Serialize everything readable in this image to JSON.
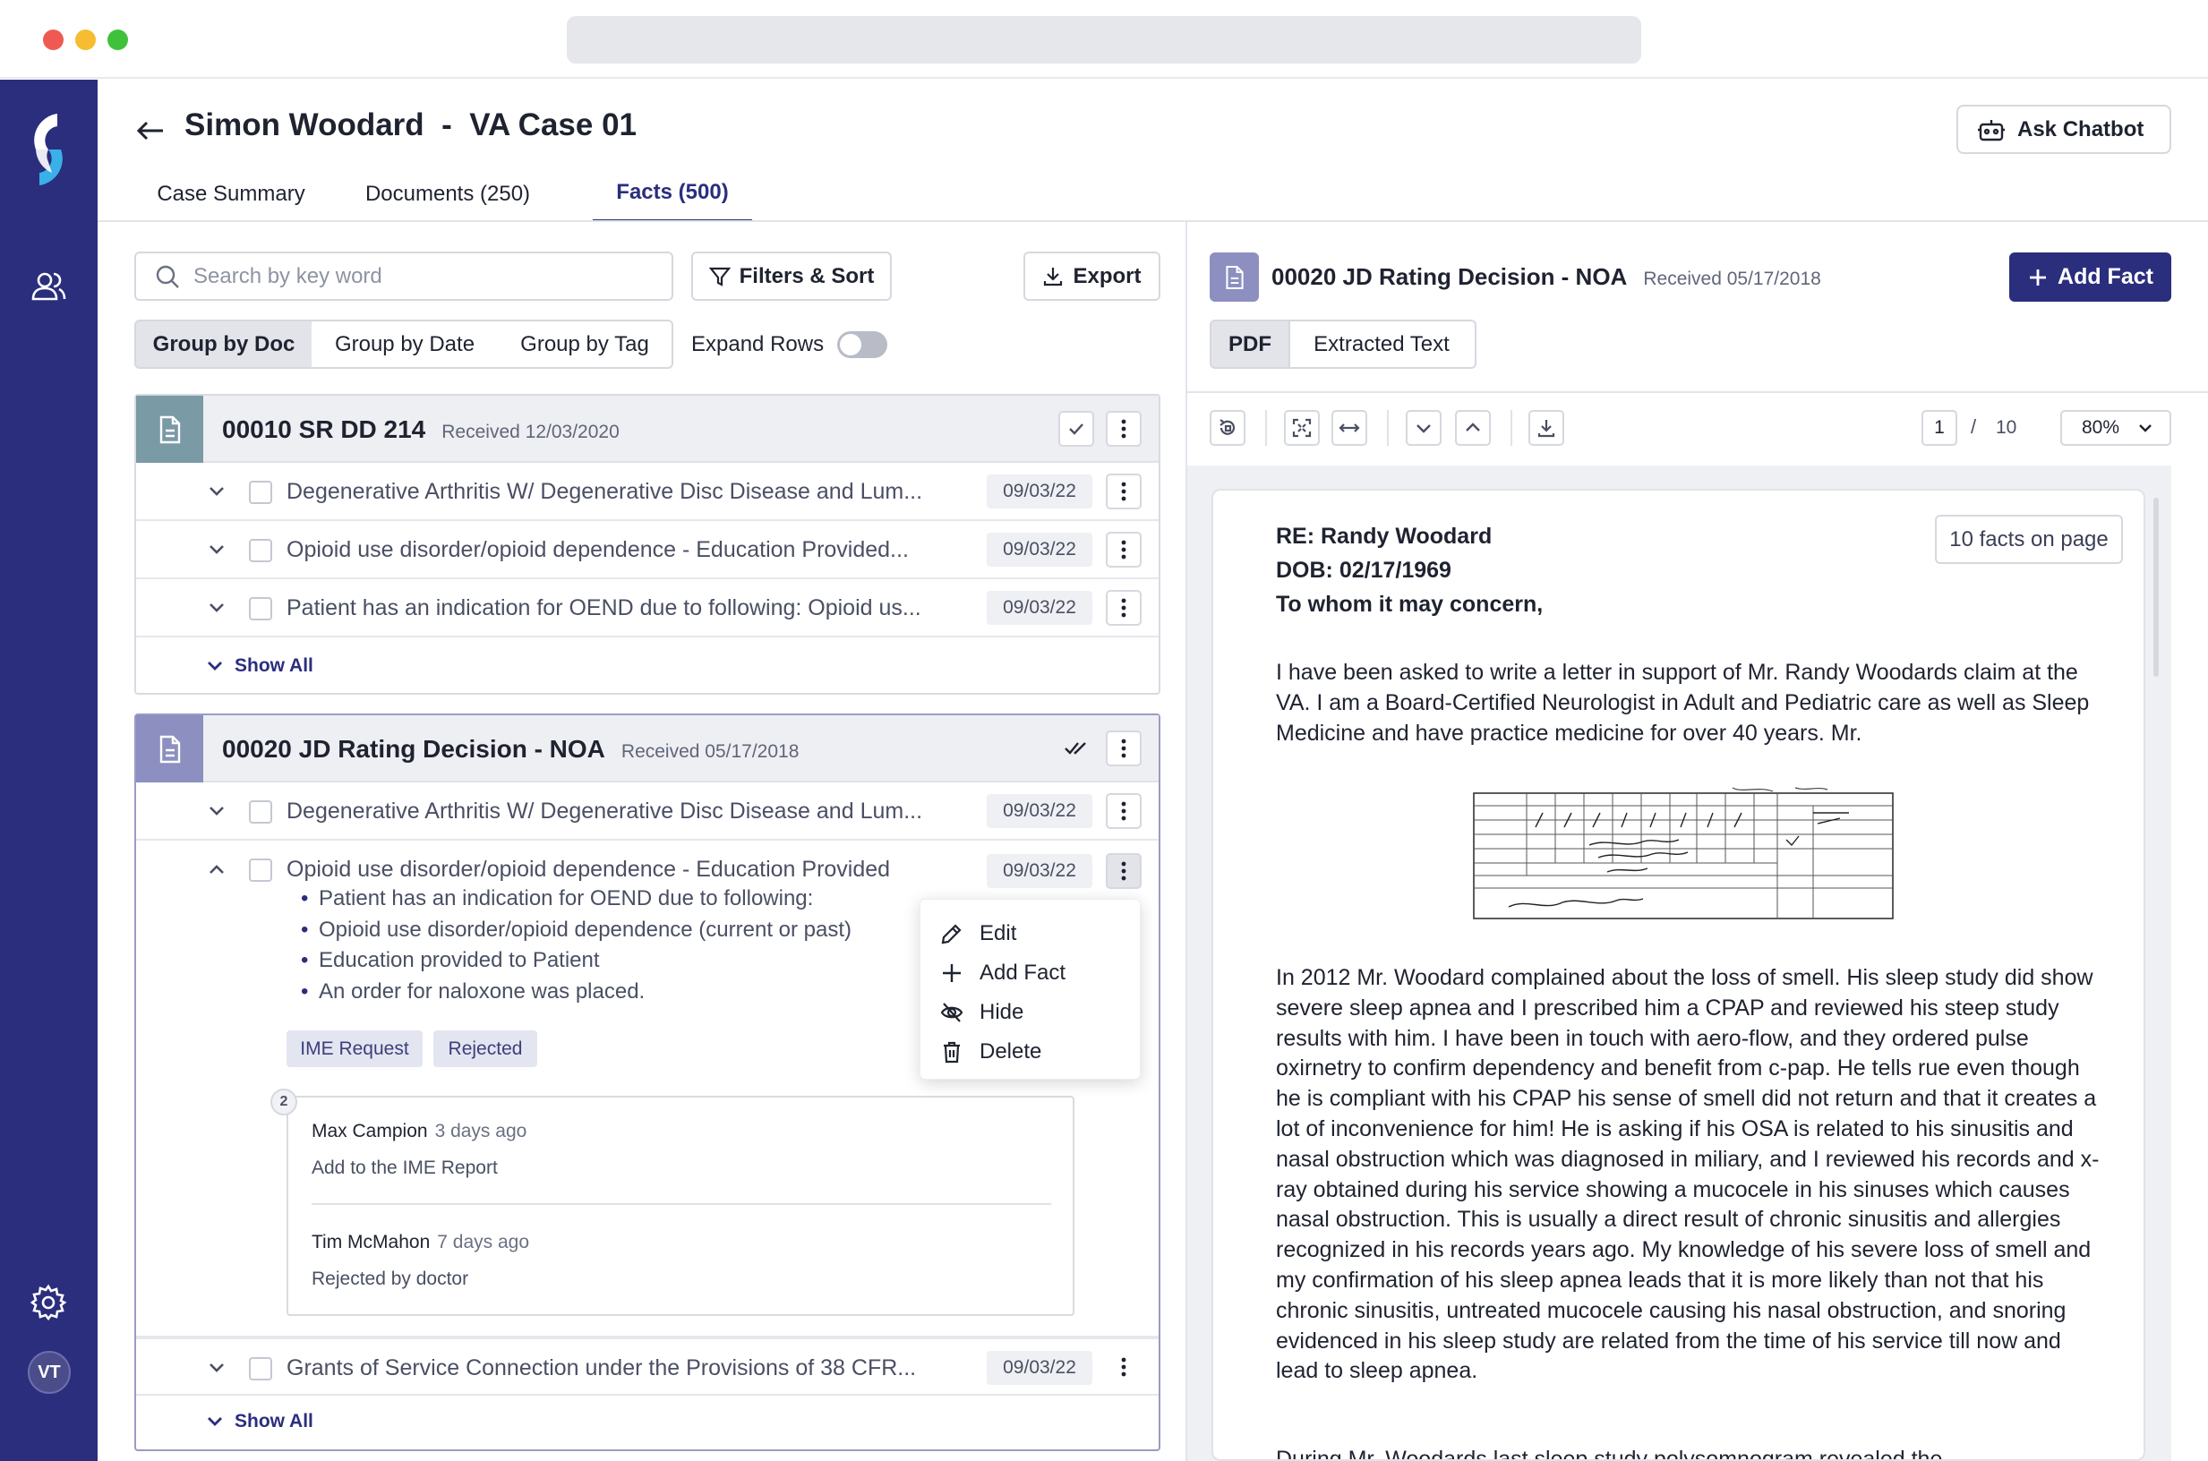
{
  "app": {
    "case_title": "Simon Woodard  -  VA Case 01",
    "ask_chatbot": "Ask Chatbot",
    "user_initials": "VT"
  },
  "tabs": [
    {
      "label": "Case Summary"
    },
    {
      "label": "Documents (250)"
    },
    {
      "label": "Facts (500)"
    }
  ],
  "toolbar": {
    "search_placeholder": "Search by key word",
    "filters_label": "Filters & Sort",
    "export_label": "Export",
    "group_by": [
      "Group by Doc",
      "Group by Date",
      "Group by Tag"
    ],
    "group_by_selected": "Group by Doc",
    "expand_rows_label": "Expand Rows",
    "expand_rows_on": false
  },
  "docs": [
    {
      "title": "00010 SR DD 214",
      "received": "Received 12/03/2020",
      "facts": [
        {
          "text": "Degenerative Arthritis W/ Degenerative Disc Disease and Lum...",
          "date": "09/03/22"
        },
        {
          "text": "Opioid use disorder/opioid dependence - Education Provided...",
          "date": "09/03/22"
        },
        {
          "text": "Patient has an indication for OEND due to following: Opioid us...",
          "date": "09/03/22"
        }
      ],
      "show_all": "Show All"
    },
    {
      "title": "00020 JD Rating Decision - NOA",
      "received": "Received 05/17/2018",
      "facts": [
        {
          "text": "Degenerative Arthritis W/ Degenerative Disc Disease and Lum...",
          "date": "09/03/22"
        },
        {
          "text": "Opioid use disorder/opioid dependence - Education Provided",
          "date": "09/03/22",
          "bullets": [
            "Patient has an indication for OEND due to following:",
            "Opioid use disorder/opioid dependence (current or past)",
            "Education provided to Patient",
            "An order for naloxone was placed."
          ],
          "tags": [
            "IME Request",
            "Rejected"
          ],
          "comment_count": "2",
          "comments": [
            {
              "author": "Max Campion",
              "time": "3 days ago",
              "body": "Add to the IME Report"
            },
            {
              "author": "Tim McMahon",
              "time": "7 days ago",
              "body": "Rejected by doctor"
            }
          ]
        },
        {
          "text": "Grants of Service Connection under the Provisions of 38 CFR...",
          "date": "09/03/22"
        }
      ],
      "show_all": "Show All"
    }
  ],
  "context_menu": [
    "Edit",
    "Add Fact",
    "Hide",
    "Delete"
  ],
  "viewer": {
    "doc_title": "00020 JD Rating Decision - NOA",
    "received": "Received 05/17/2018",
    "add_fact": "Add Fact",
    "modes": [
      "PDF",
      "Extracted Text"
    ],
    "mode_selected": "PDF",
    "page_current": "1",
    "page_sep": "/",
    "page_total": "10",
    "zoom": "80%",
    "facts_on_page": "10 facts on page",
    "letter": {
      "re": "RE: Randy Woodard",
      "dob": "DOB: 02/17/1969",
      "salutation": "To whom it may concern,",
      "p1": "I have been asked to write a letter in support of Mr. Randy Woodards claim at the VA. I am a Board-Certified Neurologist in Adult and Pediatric care as well as Sleep Medicine and have practice medicine for over 40 years. Mr.",
      "p2": "In 2012 Mr. Woodard complained about the loss of smell. His sleep study did show severe sleep apnea and I prescribed him a CPAP and reviewed his steep study results with him. I have been in touch with aero-flow, and they ordered pulse oxirnetry to confirm dependency and benefit from c-pap. He tells rue even though he is compliant with his CPAP his sense of smell did not return and that it creates a lot of inconvenience for him! He is asking if his OSA is related to his sinusitis and nasal obstruction which was diagnosed in miliary, and I reviewed his records and x-ray obtained during his service showing a mucocele in his sinuses which causes nasal obstruction. This is usually a direct result of chronic sinusitis and allergies recognized in his records years ago. My knowledge of his severe loss of smell and my confirmation of his sleep apnea leads that it is more likely than not that his chronic sinusitis, untreated mucocele causing his nasal obstruction, and snoring evidenced in his sleep study are related from the time of his service till now and lead to sleep apnea.",
      "p3": "During Mr. Woodards last sleep study polysomnogram revealed the"
    }
  },
  "colors": {
    "brand": "#2b2e7d",
    "accent_light": "#8c8fc0",
    "doc1_badge": "#7a9aa5",
    "doc2_badge": "#8c8fc0"
  }
}
